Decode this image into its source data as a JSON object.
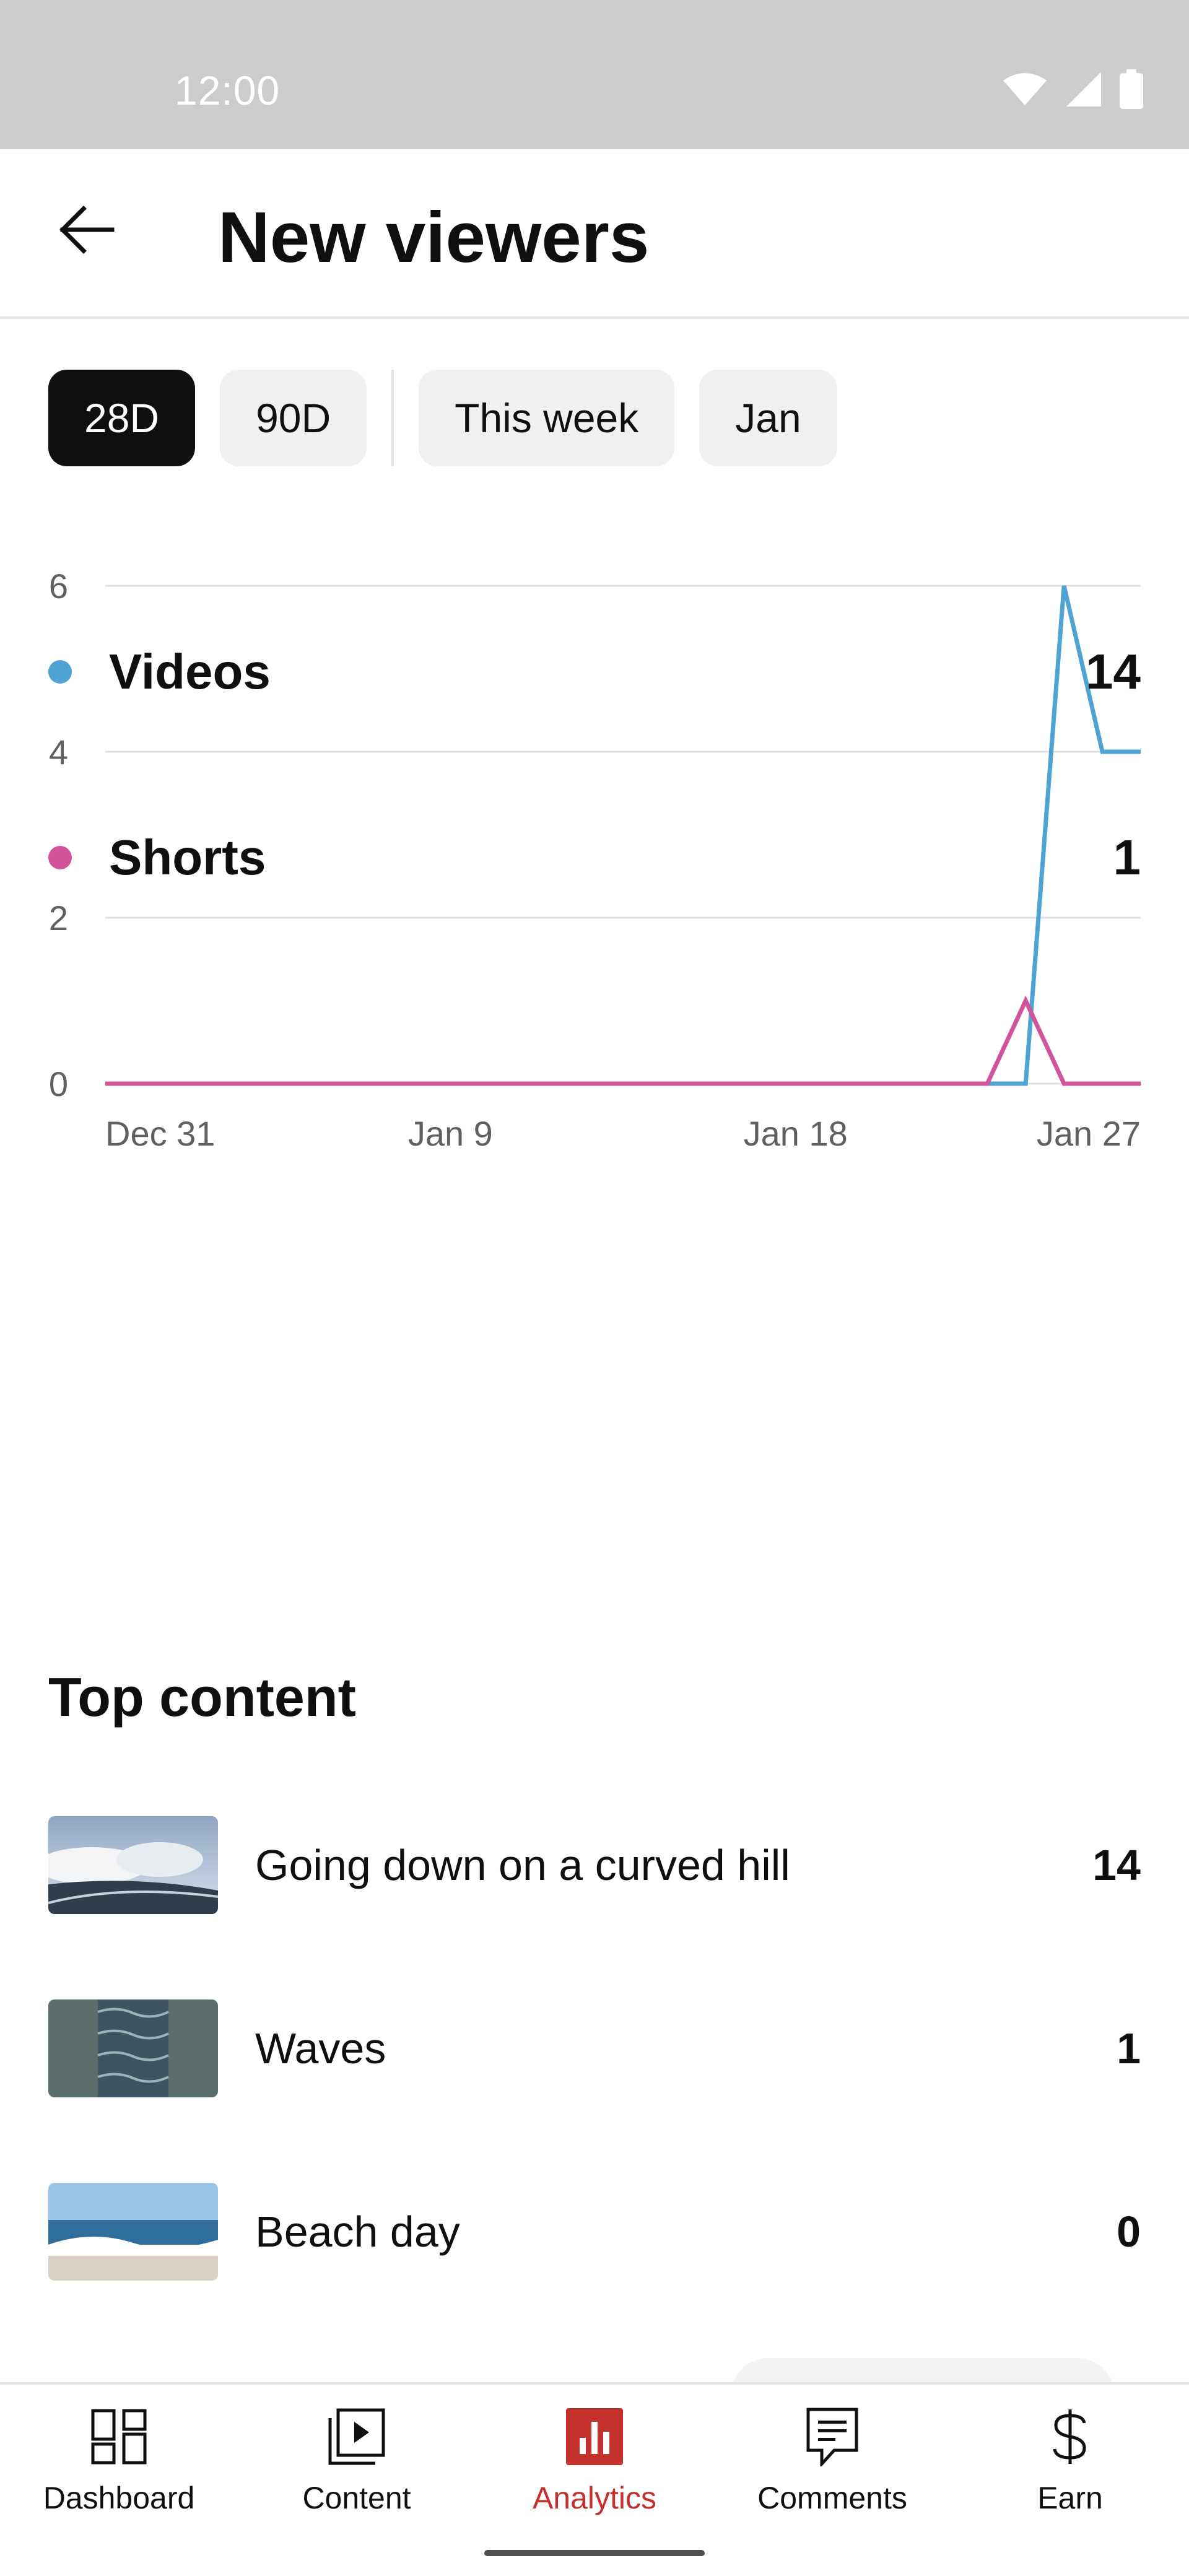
{
  "status_bar": {
    "time": "12:00"
  },
  "header": {
    "title": "New viewers"
  },
  "chips": [
    {
      "label": "28D",
      "active": true
    },
    {
      "label": "90D",
      "active": false
    },
    {
      "label": "This week",
      "active": false
    },
    {
      "label": "Jan",
      "active": false
    }
  ],
  "chart_data": {
    "type": "line",
    "x": [
      "Dec 31",
      "Jan 1",
      "Jan 2",
      "Jan 3",
      "Jan 4",
      "Jan 5",
      "Jan 6",
      "Jan 7",
      "Jan 8",
      "Jan 9",
      "Jan 10",
      "Jan 11",
      "Jan 12",
      "Jan 13",
      "Jan 14",
      "Jan 15",
      "Jan 16",
      "Jan 17",
      "Jan 18",
      "Jan 19",
      "Jan 20",
      "Jan 21",
      "Jan 22",
      "Jan 23",
      "Jan 24",
      "Jan 25",
      "Jan 26",
      "Jan 27"
    ],
    "x_ticks": [
      "Dec 31",
      "Jan 9",
      "Jan 18",
      "Jan 27"
    ],
    "y_ticks": [
      "0",
      "2",
      "4",
      "6"
    ],
    "ylim": [
      0,
      6
    ],
    "grid": true,
    "series": [
      {
        "name": "Videos",
        "color": "#4ea3d2",
        "values": [
          0,
          0,
          0,
          0,
          0,
          0,
          0,
          0,
          0,
          0,
          0,
          0,
          0,
          0,
          0,
          0,
          0,
          0,
          0,
          0,
          0,
          0,
          0,
          0,
          0,
          6,
          4,
          4
        ]
      },
      {
        "name": "Shorts",
        "color": "#d1549b",
        "values": [
          0,
          0,
          0,
          0,
          0,
          0,
          0,
          0,
          0,
          0,
          0,
          0,
          0,
          0,
          0,
          0,
          0,
          0,
          0,
          0,
          0,
          0,
          0,
          0,
          1,
          0,
          0,
          0
        ]
      }
    ]
  },
  "legend": [
    {
      "label": "Videos",
      "value": "14",
      "color": "#4ea3d2"
    },
    {
      "label": "Shorts",
      "value": "1",
      "color": "#d1549b"
    }
  ],
  "top_content": {
    "title": "Top content",
    "items": [
      {
        "title": "Going down on a curved hill",
        "value": "14",
        "thumb": "hill"
      },
      {
        "title": "Waves",
        "value": "1",
        "thumb": "waves"
      },
      {
        "title": "Beach day",
        "value": "0",
        "thumb": "beach"
      }
    ]
  },
  "bottom_nav": [
    {
      "label": "Dashboard",
      "icon": "dashboard-icon",
      "active": false
    },
    {
      "label": "Content",
      "icon": "content-icon",
      "active": false
    },
    {
      "label": "Analytics",
      "icon": "analytics-icon",
      "active": true
    },
    {
      "label": "Comments",
      "icon": "comments-icon",
      "active": false
    },
    {
      "label": "Earn",
      "icon": "earn-icon",
      "active": false
    }
  ],
  "colors": {
    "accent": "#c4302b",
    "videos": "#4ea3d2",
    "shorts": "#d1549b"
  }
}
